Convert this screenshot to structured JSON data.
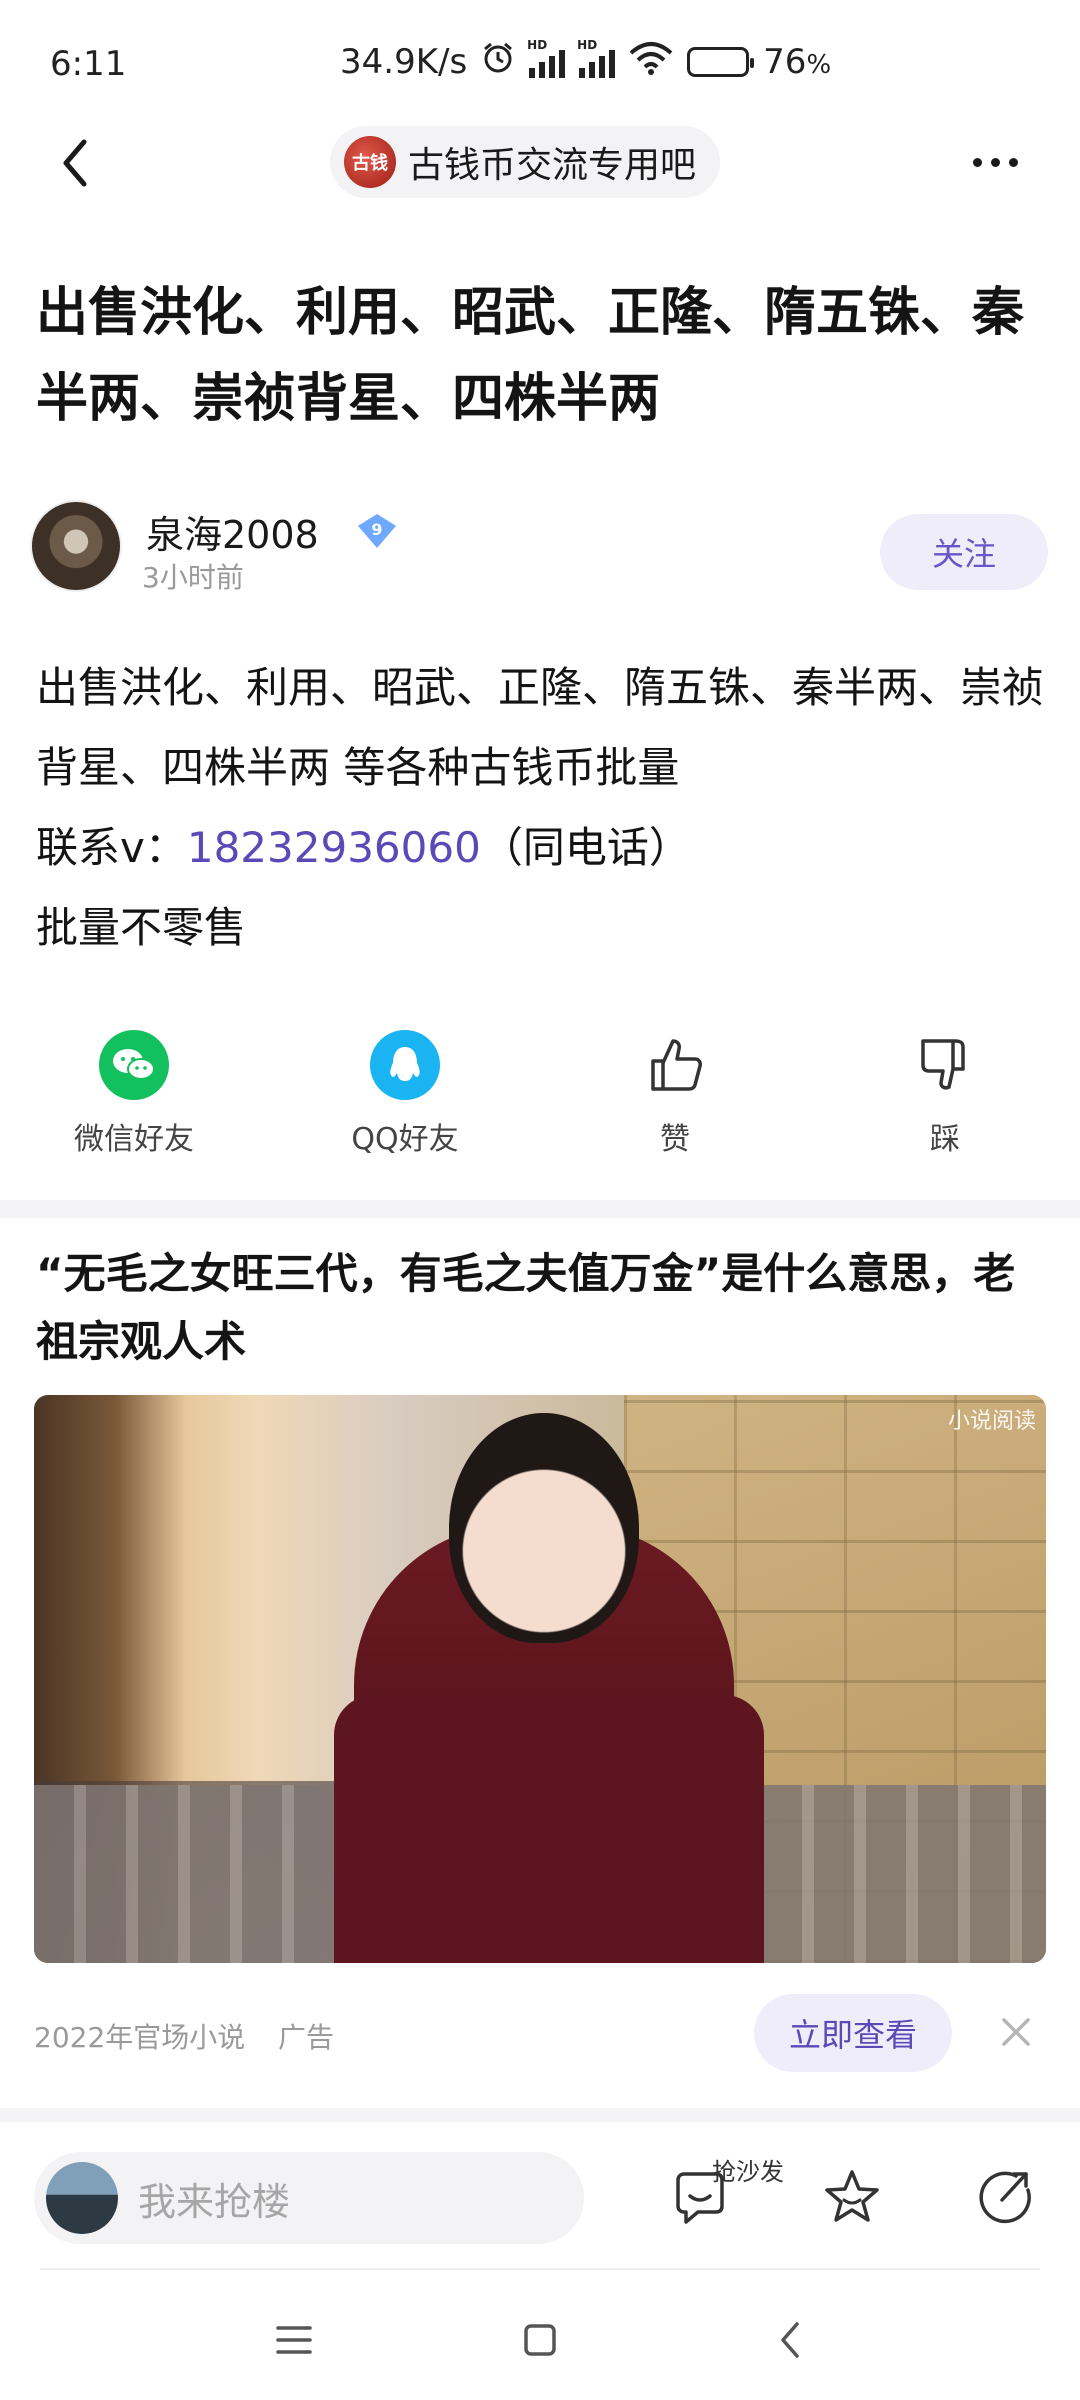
{
  "status_bar": {
    "time": "6:11",
    "net_speed": "34.9K/s",
    "battery": "76",
    "battery_unit": "%",
    "signal_label": "HD",
    "battery_level": 0.76
  },
  "nav": {
    "forum_logo_text": "古钱",
    "forum_name": "古钱币交流专用吧"
  },
  "post": {
    "title": "出售洪化、利用、昭武、正隆、隋五铢、秦半两、崇祯背星、四株半两",
    "author": {
      "name": "泉海2008",
      "level": "9",
      "time": "3小时前",
      "follow_label": "关注"
    },
    "body": {
      "line1": "出售洪化、利用、昭武、正隆、隋五铢、秦半两、崇祯背星、四株半两 等各种古钱币批量",
      "contact_prefix": "联系v：",
      "contact_number": "18232936060",
      "contact_suffix": "（同电话）",
      "line3": "批量不零售"
    }
  },
  "actions": [
    {
      "label": "微信好友",
      "icon": "wechat-icon"
    },
    {
      "label": "QQ好友",
      "icon": "qq-icon"
    },
    {
      "label": "赞",
      "icon": "thumbs-up-icon"
    },
    {
      "label": "踩",
      "icon": "thumbs-down-icon"
    }
  ],
  "ad": {
    "title": "“无毛之女旺三代，有毛之夫值万金”是什么意思，老祖宗观人术",
    "watermark": "小说阅读",
    "source": "2022年官场小说",
    "tag": "广告",
    "cta": "立即查看"
  },
  "reply_bar": {
    "placeholder": "我来抢楼",
    "sofa_label": "抢沙发"
  },
  "colors": {
    "accent": "#5b49b8",
    "accent_bg": "#efedfa",
    "wechat": "#12c15e",
    "qq": "#1ab4f2"
  }
}
